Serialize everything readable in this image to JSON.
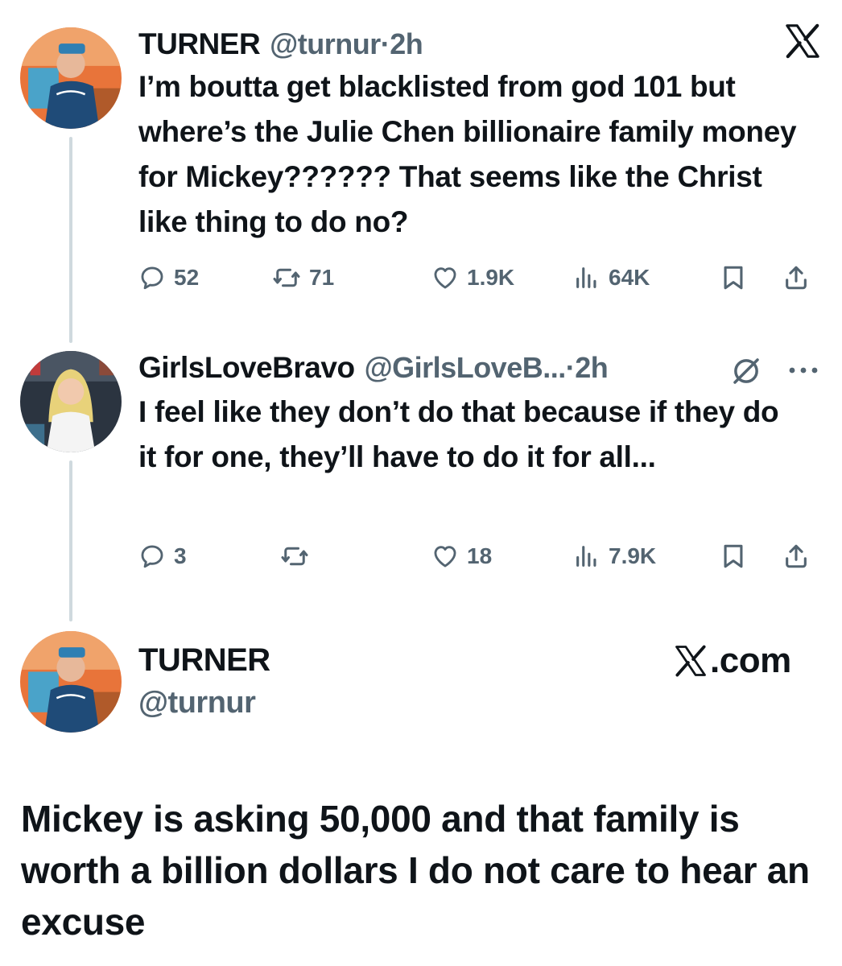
{
  "tweet1": {
    "name": "TURNER",
    "handle": "@turnur",
    "time": "·2h",
    "text": "I’m boutta get blacklisted from god 101 but where’s the Julie Chen billionaire family money for Mickey?????? That seems like the Christ like thing to do no?",
    "replies": "52",
    "retweets": "71",
    "likes": "1.9K",
    "views": "64K"
  },
  "tweet2": {
    "name": "GirlsLoveBravo",
    "handle": "@GirlsLoveB...",
    "time": "·2h",
    "text": "I feel like they don’t do that because if they do it for one, they’ll have to do it for all...",
    "replies": "3",
    "retweets": "",
    "likes": "18",
    "views": "7.9K"
  },
  "card": {
    "name": "TURNER",
    "handle": "@turnur",
    "brand": ".com",
    "quote": "Mickey is asking 50,000 and that family is worth a billion dollars I do not care to hear an excuse"
  },
  "icons": {
    "top_right": "x-logo-icon",
    "muted": "mute-icon",
    "more": "more-icon",
    "reply": "reply-icon",
    "retweet": "retweet-icon",
    "like": "heart-icon",
    "views": "views-icon",
    "bookmark": "bookmark-icon",
    "share": "share-icon"
  },
  "colors": {
    "text": "#0f1419",
    "secondary": "#536471",
    "thread_line": "#cfd9de"
  }
}
